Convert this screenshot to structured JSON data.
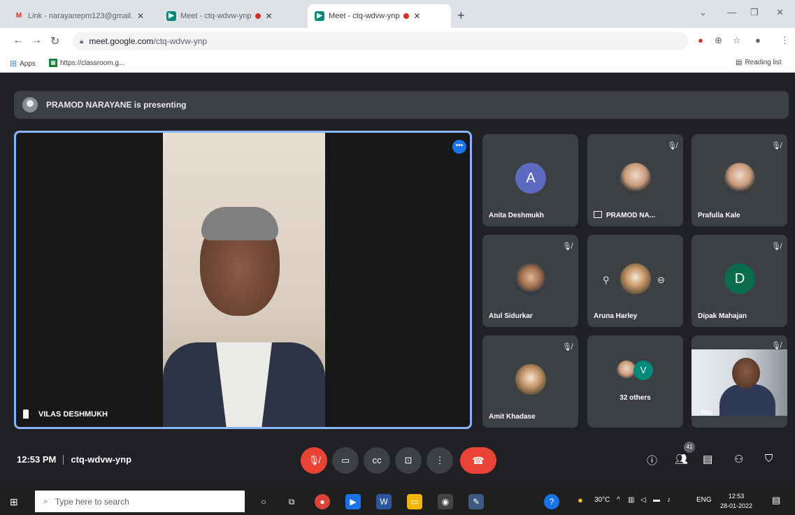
{
  "browser": {
    "tabs": [
      {
        "title": "Link - narayanepm123@gmail.c",
        "icon": "gmail-icon",
        "active": false
      },
      {
        "title": "Meet - ctq-wdvw-ynp",
        "icon": "meet-icon",
        "active": false,
        "recording": true
      },
      {
        "title": "Meet - ctq-wdvw-ynp",
        "icon": "meet-icon",
        "active": true,
        "recording": true
      }
    ],
    "new_tab": "+",
    "url_host": "meet.google.com",
    "url_path": "/ctq-wdvw-ynp",
    "bookmarks": {
      "apps": "Apps",
      "classroom": "https://classroom.g...",
      "reading_list": "Reading list"
    }
  },
  "meet": {
    "presenting_banner": "PRAMOD NARAYANE is presenting",
    "main_speaker": "VILAS DESHMUKH",
    "participants": [
      {
        "name": "Anita Deshmukh",
        "initial": "A",
        "color": "#5c6bc0",
        "muted": false
      },
      {
        "name": "PRAMOD NA...",
        "photo": true,
        "presenting": true,
        "muted": true
      },
      {
        "name": "Prafulla Kale",
        "photo": true,
        "muted": true
      },
      {
        "name": "Atul Sidurkar",
        "photo": true,
        "muted": true
      },
      {
        "name": "Aruna Harley",
        "photo": true,
        "muted": false
      },
      {
        "name": "Dipak Mahajan",
        "initial": "D",
        "color": "#0b6b4d",
        "muted": true
      },
      {
        "name": "Amit Khadase",
        "photo": true,
        "muted": true
      },
      {
        "others": "32 others",
        "initial": "V",
        "color": "#00897b"
      },
      {
        "name": "You",
        "self": true,
        "muted": true
      }
    ],
    "time": "12:53 PM",
    "meeting_code": "ctq-wdvw-ynp",
    "participant_count": "41",
    "colors": {
      "accent": "#8ab4f8",
      "danger": "#ea4335",
      "tile": "#3c4043",
      "background": "#202124"
    }
  },
  "taskbar": {
    "search_placeholder": "Type here to search",
    "weather": "30°C",
    "lang": "ENG",
    "clock_time": "12:53",
    "clock_date": "28-01-2022"
  }
}
